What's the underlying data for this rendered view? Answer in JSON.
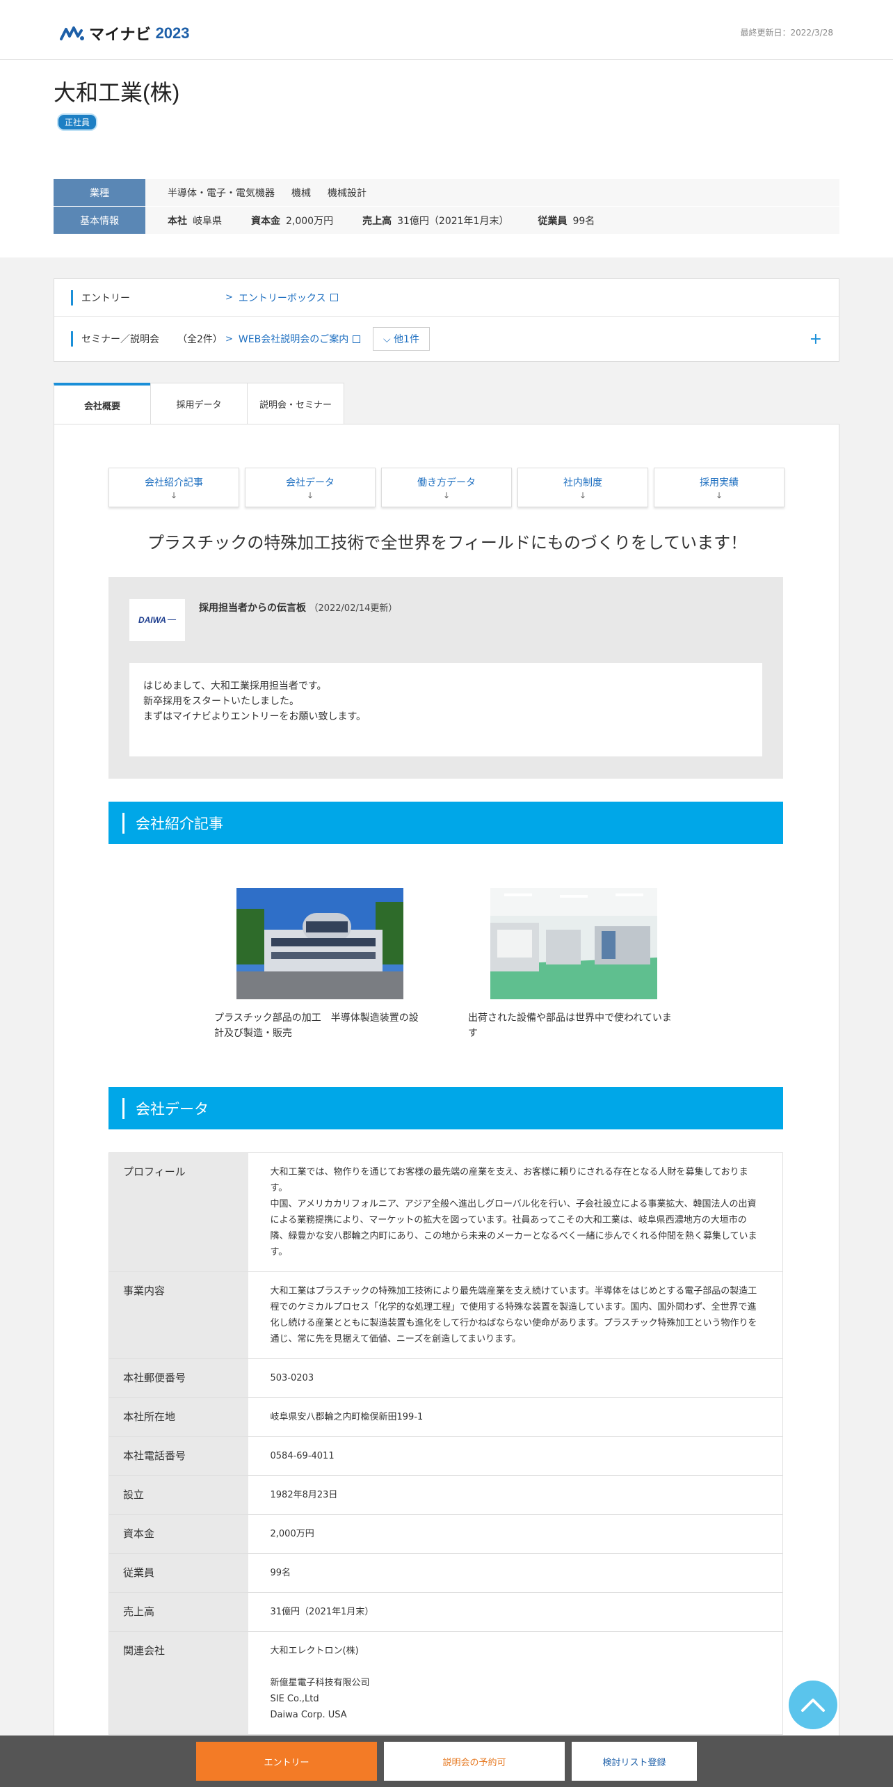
{
  "header": {
    "logo_text": "マイナビ",
    "logo_year": "2023",
    "last_updated": "最終更新日：2022/3/28"
  },
  "company": {
    "name": "大和工業(株)",
    "badge": "正社員"
  },
  "info": {
    "industry_label": "業種",
    "industries": [
      "半導体・電子・電気機器",
      "機械",
      "機械設計"
    ],
    "basic_label": "基本情報",
    "hq_label": "本社",
    "hq_value": "岐阜県",
    "capital_label": "資本金",
    "capital_value": "2,000万円",
    "sales_label": "売上高",
    "sales_value": "31億円（2021年1月末）",
    "employees_label": "従業員",
    "employees_value": "99名"
  },
  "entry": {
    "entry_label": "エントリー",
    "entry_link": "エントリーボックス",
    "seminar_label": "セミナー／説明会",
    "seminar_count": "（全2件）",
    "seminar_link": "WEB会社説明会のご案内",
    "more": "他1件",
    "plus": "+"
  },
  "tabs": [
    {
      "label": "会社概要"
    },
    {
      "label": "採用データ"
    },
    {
      "label": "説明会・セミナー"
    }
  ],
  "anchors": [
    {
      "label": "会社紹介記事"
    },
    {
      "label": "会社データ"
    },
    {
      "label": "働き方データ"
    },
    {
      "label": "社内制度"
    },
    {
      "label": "採用実績"
    }
  ],
  "catch_copy": "プラスチックの特殊加工技術で全世界をフィールドにものづくりをしています！",
  "message": {
    "logo_text": "DAIWA",
    "title": "採用担当者からの伝言板",
    "date": "（2022/02/14更新）",
    "lines": [
      "はじめまして、大和工業採用担当者です。",
      "新卒採用をスタートいたしました。",
      "まずはマイナビよりエントリーをお願い致します。"
    ]
  },
  "section_articles": "会社紹介記事",
  "articles": [
    {
      "caption": "プラスチック部品の加工　半導体製造装置の設計及び製造・販売"
    },
    {
      "caption": "出荷された設備や部品は世界中で使われています"
    }
  ],
  "section_data": "会社データ",
  "company_data": [
    {
      "key": "プロフィール",
      "value": "大和工業では、物作りを通じてお客様の最先端の産業を支え、お客様に頼りにされる存在となる人財を募集しております。\n中国、アメリカカリフォルニア、アジア全般へ進出しグローバル化を行い、子会社設立による事業拡大、韓国法人の出資による業務提携により、マーケットの拡大を図っています。社員あってこその大和工業は、岐阜県西濃地方の大垣市の隣、緑豊かな安八郡輪之内町にあり、この地から未来のメーカーとなるべく一緒に歩んでくれる仲間を熱く募集しています。"
    },
    {
      "key": "事業内容",
      "value": "大和工業はプラスチックの特殊加工技術により最先端産業を支え続けています。半導体をはじめとする電子部品の製造工程でのケミカルプロセス「化学的な処理工程」で使用する特殊な装置を製造しています。国内、国外問わず、全世界で進化し続ける産業とともに製造装置も進化をして行かねばならない使命があります。プラスチック特殊加工という物作りを通じ、常に先を見据えて価値、ニーズを創造してまいります。"
    },
    {
      "key": "本社郵便番号",
      "value": "503-0203"
    },
    {
      "key": "本社所在地",
      "value": "岐阜県安八郡輪之内町楡俣新田199-1"
    },
    {
      "key": "本社電話番号",
      "value": "0584-69-4011"
    },
    {
      "key": "設立",
      "value": "1982年8月23日"
    },
    {
      "key": "資本金",
      "value": "2,000万円"
    },
    {
      "key": "従業員",
      "value": "99名"
    },
    {
      "key": "売上高",
      "value": "31億円（2021年1月末）"
    },
    {
      "key": "関連会社",
      "value": "大和エレクトロン(株)\n\n新億星電子科技有限公司\nSIE Co.,Ltd\nDaiwa Corp. USA"
    }
  ],
  "footer": {
    "entry": "エントリー",
    "seminar": "説明会の予約可",
    "list": "検討リスト登録"
  },
  "colors": {
    "accent": "#00a7e8",
    "label_blue": "#5a87b5",
    "entry_orange": "#f37b26"
  }
}
